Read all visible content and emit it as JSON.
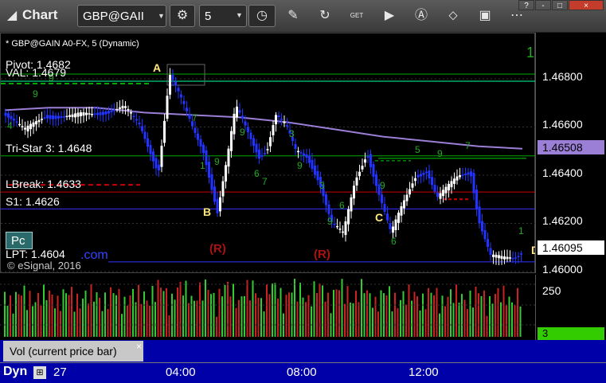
{
  "titlebar": {
    "app_title": "Chart",
    "symbol": "GBP@GAII",
    "interval": "5",
    "win_buttons": [
      "?",
      "-",
      "□",
      "×"
    ],
    "icons": [
      "chart-logo-icon",
      "gear-icon",
      "clock-icon",
      "pencil-icon",
      "refresh-icon",
      "get-icon",
      "play-icon",
      "alert-icon",
      "tag-icon",
      "comment-icon",
      "more-icon"
    ]
  },
  "chart": {
    "header": "* GBP@GAIN A0-FX, 5 (Dynamic)",
    "copyright": "© eSignal, 2016",
    "pc_label": "Pc",
    "com_label": ".com",
    "levels": [
      {
        "label": "Pivot: 1.4682",
        "price": 1.4682,
        "color": "#00aa00"
      },
      {
        "label": "VAL: 1.4679",
        "price": 1.4679,
        "color": "#00ff99"
      },
      {
        "label": "Tri-Star 3: 1.4648",
        "price": 1.4648,
        "color": "#00aa00"
      },
      {
        "label": "LBreak: 1.4633",
        "price": 1.4633,
        "color": "#cc0000"
      },
      {
        "label": "S1: 1.4626",
        "price": 1.4626,
        "color": "#3333ff"
      },
      {
        "label": "LPT: 1.4604",
        "price": 1.4604,
        "color": "#3333ff"
      }
    ],
    "points": [
      "A",
      "B",
      "C",
      "D"
    ],
    "reversal_labels": [
      "(R)",
      "(R)"
    ],
    "count_digits": [
      "1",
      "9",
      "9",
      "4",
      "7",
      "1",
      "9",
      "9",
      "6",
      "7",
      "3",
      "9",
      "3",
      "9",
      "6",
      "9",
      "6",
      "5",
      "9",
      "7",
      "1"
    ],
    "price_ticks": [
      "1.46800",
      "1.46600",
      "1.46400",
      "1.46200",
      "1.46000"
    ],
    "price_markers": [
      {
        "value": "1.46508",
        "color": "#9b7fd6"
      },
      {
        "value": "1.46095",
        "color": "#ffffff"
      }
    ],
    "colors": {
      "up_bar": "#ffffff",
      "down_bar": "#2233ff",
      "ma": "#9b7fd6",
      "background": "#000000"
    }
  },
  "volume": {
    "label": "Vol (current price bar)",
    "close_label": "×",
    "ticks": [
      "250"
    ],
    "current_value": "3",
    "current_color": "#33cc00"
  },
  "timeaxis": {
    "mode_label": "Dyn",
    "day_label": "27",
    "labels": [
      "04:00",
      "08:00",
      "12:00"
    ]
  }
}
